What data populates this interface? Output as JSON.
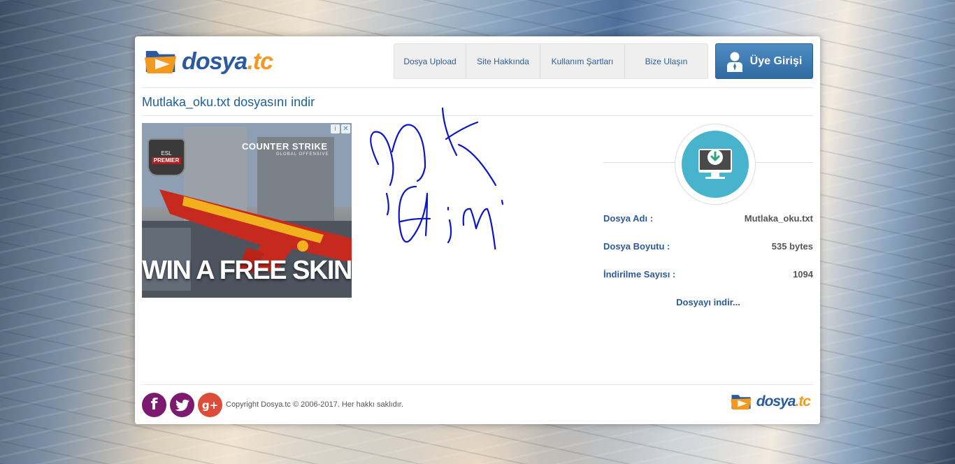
{
  "brand": {
    "name_main": "dosya",
    "name_tld": ".tc"
  },
  "nav": {
    "items": [
      {
        "label": "Dosya Upload"
      },
      {
        "label": "Site Hakkında"
      },
      {
        "label": "Kullanım Şartları"
      },
      {
        "label": "Bize Ulaşın"
      }
    ],
    "login_label": "Üye Girişi"
  },
  "page": {
    "title": "Mutlaka_oku.txt dosyasını indir"
  },
  "ad": {
    "brand": "COUNTER STRIKE",
    "subline": "GLOBAL OFFENSIVE",
    "badge_top": "ESL",
    "badge_main": "PREMIER",
    "headline": "WIN A FREE SKIN"
  },
  "file_info": {
    "rows": [
      {
        "label": "Dosya Adı :",
        "value": "Mutlaka_oku.txt"
      },
      {
        "label": "Dosya Boyutu :",
        "value": "535 bytes"
      },
      {
        "label": "İndirilme Sayısı :",
        "value": "1094"
      }
    ],
    "download_link": "Dosyayı indir..."
  },
  "footer": {
    "copyright": "Copyright Dosya.tc © 2006-2017. Her hakkı saklıdır.",
    "social": [
      {
        "name": "facebook",
        "glyph": "f",
        "color": "#7b1a6e"
      },
      {
        "name": "twitter",
        "glyph": "t",
        "color": "#7b1a6e"
      },
      {
        "name": "google-plus",
        "glyph": "g+",
        "color": "#dd4b39"
      }
    ]
  },
  "colors": {
    "accent_blue": "#2a5aa0",
    "accent_orange": "#f39a1e",
    "download_circle": "#47b3cd",
    "login_button": "#3b78b3"
  }
}
